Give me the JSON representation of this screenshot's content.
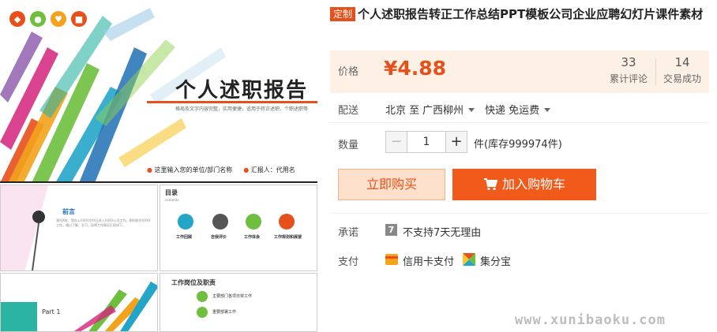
{
  "preview": {
    "cover_title": "个人述职报告",
    "cover_subtitle": "格局及文字内容完整，实用便捷，适用于转正述职、个职述职等",
    "cover_unit_label": "这里输入您的单位/部门名称",
    "cover_reporter_label": "汇报人：代用名",
    "thumb1_heading": "前言",
    "thumb1_body": "我叫X姓，我在公司XX月XX日进入XXXX公司工作，期间担任XXXX工作，通过了解、学习，现将工作情况汇报如下。",
    "thumb2_heading": "目录",
    "thumb2_sub": "contents",
    "thumb2_items": [
      "工作回顾",
      "自我评价",
      "工作体会",
      "工作规划和展望"
    ],
    "thumb3_label": "Part 1",
    "thumb4_heading": "工作岗位及职责",
    "thumb4_items": [
      "主要部门各项日常工作",
      "重要部署工作"
    ]
  },
  "product": {
    "badge": "定制",
    "title": "个人述职报告转正工作总结PPT模板公司企业应聘幻灯片课件素材"
  },
  "price": {
    "label": "价格",
    "value": "¥4.88",
    "reviews_count": "33",
    "reviews_label": "累计评论",
    "deals_count": "14",
    "deals_label": "交易成功"
  },
  "shipping": {
    "label": "配送",
    "from": "北京 至",
    "to": "广西柳州",
    "method": "快递 免运费"
  },
  "quantity": {
    "label": "数量",
    "minus": "−",
    "value": "1",
    "plus": "+",
    "stock": "件(库存999974件)"
  },
  "actions": {
    "buy_now": "立即购买",
    "add_to_cart": "加入购物车"
  },
  "promise": {
    "label": "承诺",
    "icon_glyph": "7",
    "text": "不支持7天无理由"
  },
  "payment": {
    "label": "支付",
    "method1": "信用卡支付",
    "method2": "集分宝"
  },
  "watermark": "www.xunibaoku.com",
  "colors": {
    "accent": "#e8501b",
    "price_bg": "#fdf1e6",
    "cart_button": "#f15a1a",
    "buy_button_bg": "#fde0cc"
  }
}
